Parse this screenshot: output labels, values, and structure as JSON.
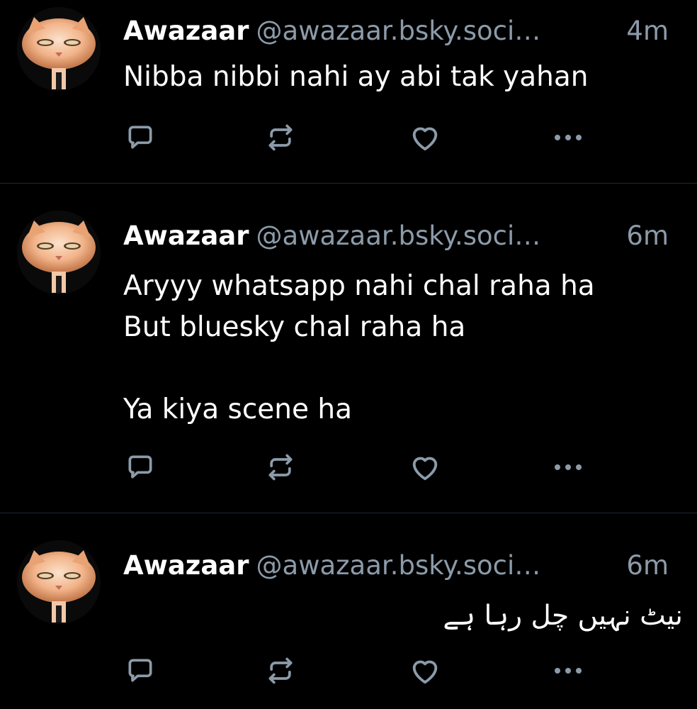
{
  "colors": {
    "background": "#000000",
    "text": "#ffffff",
    "muted": "#8c9ba9",
    "divider": "#1e2937"
  },
  "icons": {
    "reply": "reply-bubble-icon",
    "repost": "repost-icon",
    "like": "heart-icon",
    "more": "more-dots-icon"
  },
  "posts": [
    {
      "author_name": "Awazaar",
      "author_handle": "@awazaar.bsky.soci…",
      "time": "4m",
      "text_lines": [
        "Nibba nibbi nahi ay abi tak yahan"
      ]
    },
    {
      "author_name": "Awazaar",
      "author_handle": "@awazaar.bsky.soci…",
      "time": "6m",
      "text_lines": [
        "Aryyy whatsapp nahi chal raha ha",
        "But bluesky chal raha ha",
        "",
        "Ya kiya scene ha"
      ]
    },
    {
      "author_name": "Awazaar",
      "author_handle": "@awazaar.bsky.soci…",
      "time": "6m",
      "text_lines": [
        "نیٹ نہیں چل رہا ہے"
      ]
    }
  ]
}
